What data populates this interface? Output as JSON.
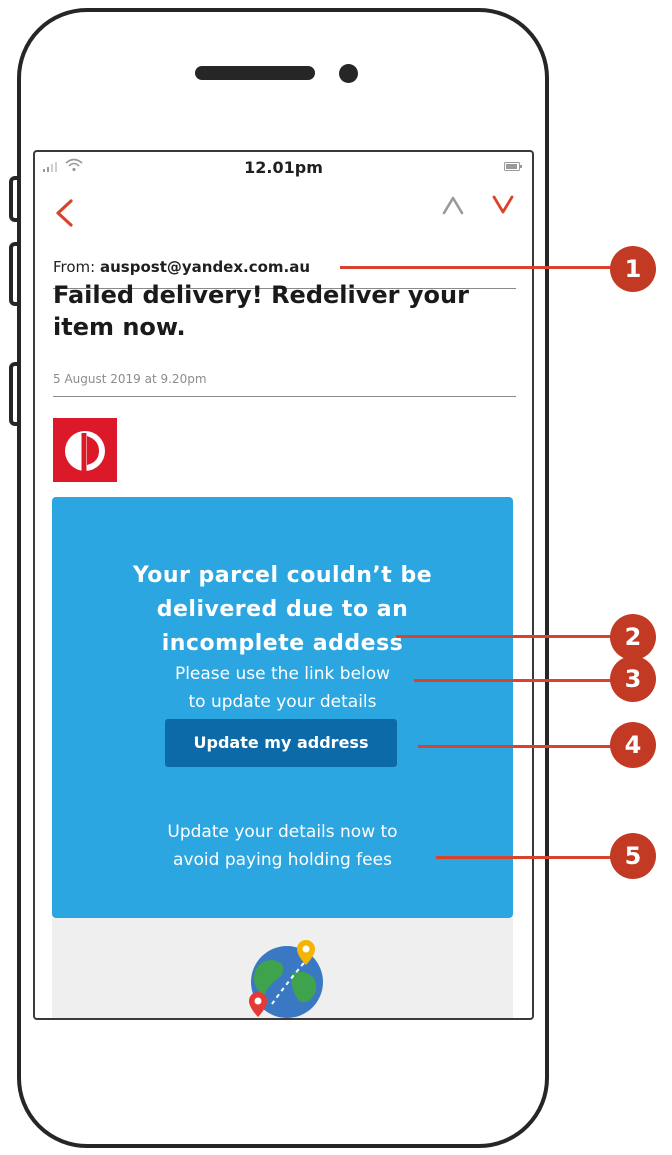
{
  "status_bar": {
    "time": "12.01pm"
  },
  "nav": {
    "back_icon": "chevron-left-icon",
    "prev_icon": "chevron-up-icon",
    "next_icon": "chevron-down-icon"
  },
  "email": {
    "from_label": "From:",
    "from_address": "auspost@yandex.com.au",
    "subject": "Failed delivery! Redeliver your item now.",
    "date": "5 August 2019 at 9.20pm"
  },
  "body": {
    "headline": "Your parcel couldn’t be delivered due to an incomplete addess",
    "instruction_line1": "Please use the link below",
    "instruction_line2": "to update your details",
    "button_label": "Update my address",
    "footer_line1": "Update your details now to",
    "footer_line2": "avoid paying holding fees"
  },
  "callouts": [
    "1",
    "2",
    "3",
    "4",
    "5"
  ],
  "colors": {
    "brand_red": "#dc1928",
    "panel_blue": "#2ca6e0",
    "button_blue": "#0d6aa8",
    "callout_red": "#c23a24",
    "nav_red": "#d9432b"
  }
}
